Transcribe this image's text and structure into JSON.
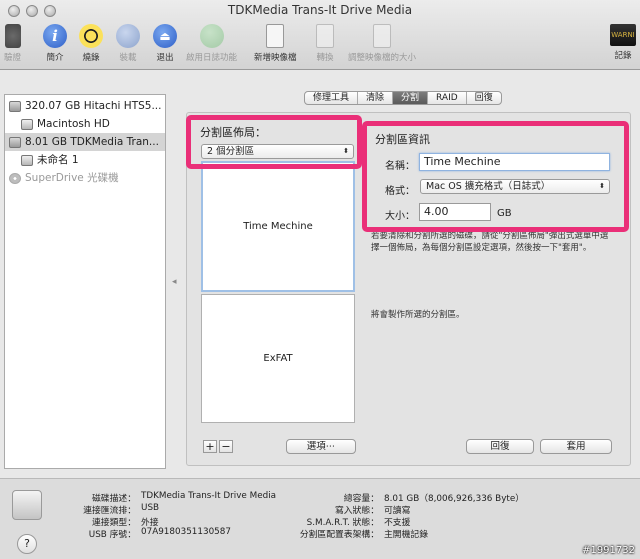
{
  "window": {
    "title": "TDKMedia Trans-It Drive Media"
  },
  "toolbar": {
    "verify": "驗證",
    "info": "簡介",
    "burn": "燒錄",
    "mount": "裝載",
    "eject": "退出",
    "enable_log": "啟用日誌功能",
    "new_image": "新增映像檔",
    "convert": "轉換",
    "resize_image": "調整映像檔的大小",
    "log": "記錄",
    "log_icon_text": "WARNI"
  },
  "sidebar": {
    "items": [
      {
        "label": "320.07 GB Hitachi HTS5..."
      },
      {
        "label": "Macintosh HD"
      },
      {
        "label": "8.01 GB TDKMedia Tran..."
      },
      {
        "label": "未命名 1"
      },
      {
        "label": "SuperDrive 光碟機"
      }
    ]
  },
  "tabs": [
    {
      "label": "修理工具"
    },
    {
      "label": "清除"
    },
    {
      "label": "分割"
    },
    {
      "label": "RAID"
    },
    {
      "label": "回復"
    }
  ],
  "partition": {
    "layout_label": "分割區佈局：",
    "layout_value": "2 個分割區",
    "partitions": [
      {
        "name": "Time Mechine"
      },
      {
        "name": "ExFAT"
      }
    ],
    "add": "+",
    "remove": "−",
    "options": "選項⋯",
    "revert": "回復",
    "apply": "套用"
  },
  "info": {
    "title": "分割區資訊",
    "name_label": "名稱：",
    "name_value": "Time Mechine",
    "format_label": "格式：",
    "format_value": "Mac OS 擴充格式（日誌式）",
    "size_label": "大小：",
    "size_value": "4.00",
    "size_unit": "GB",
    "description": "若要清除和分割所選的磁碟，請從\"分割區佈局\"彈出式選單中選擇一個佈局，為每個分割區設定選項，然後按一下\"套用\"。",
    "status": "將會製作所選的分割區。"
  },
  "footer": {
    "left": [
      {
        "k": "磁碟描述：",
        "v": "TDKMedia Trans-It Drive Media"
      },
      {
        "k": "連接匯流排：",
        "v": "USB"
      },
      {
        "k": "連接類型：",
        "v": "外接"
      },
      {
        "k": "USB 序號：",
        "v": "07A9180351130587"
      }
    ],
    "right": [
      {
        "k": "總容量：",
        "v": "8.01 GB（8,006,926,336 Byte）"
      },
      {
        "k": "寫入狀態：",
        "v": "可讀寫"
      },
      {
        "k": "S.M.A.R.T. 狀態：",
        "v": "不支援"
      },
      {
        "k": "分割區配置表架構：",
        "v": "主開機記錄"
      }
    ],
    "help": "?"
  },
  "watermark": "#1991732",
  "colors": {
    "highlight": "#ea2f78",
    "selection": "#9fc0e6"
  }
}
